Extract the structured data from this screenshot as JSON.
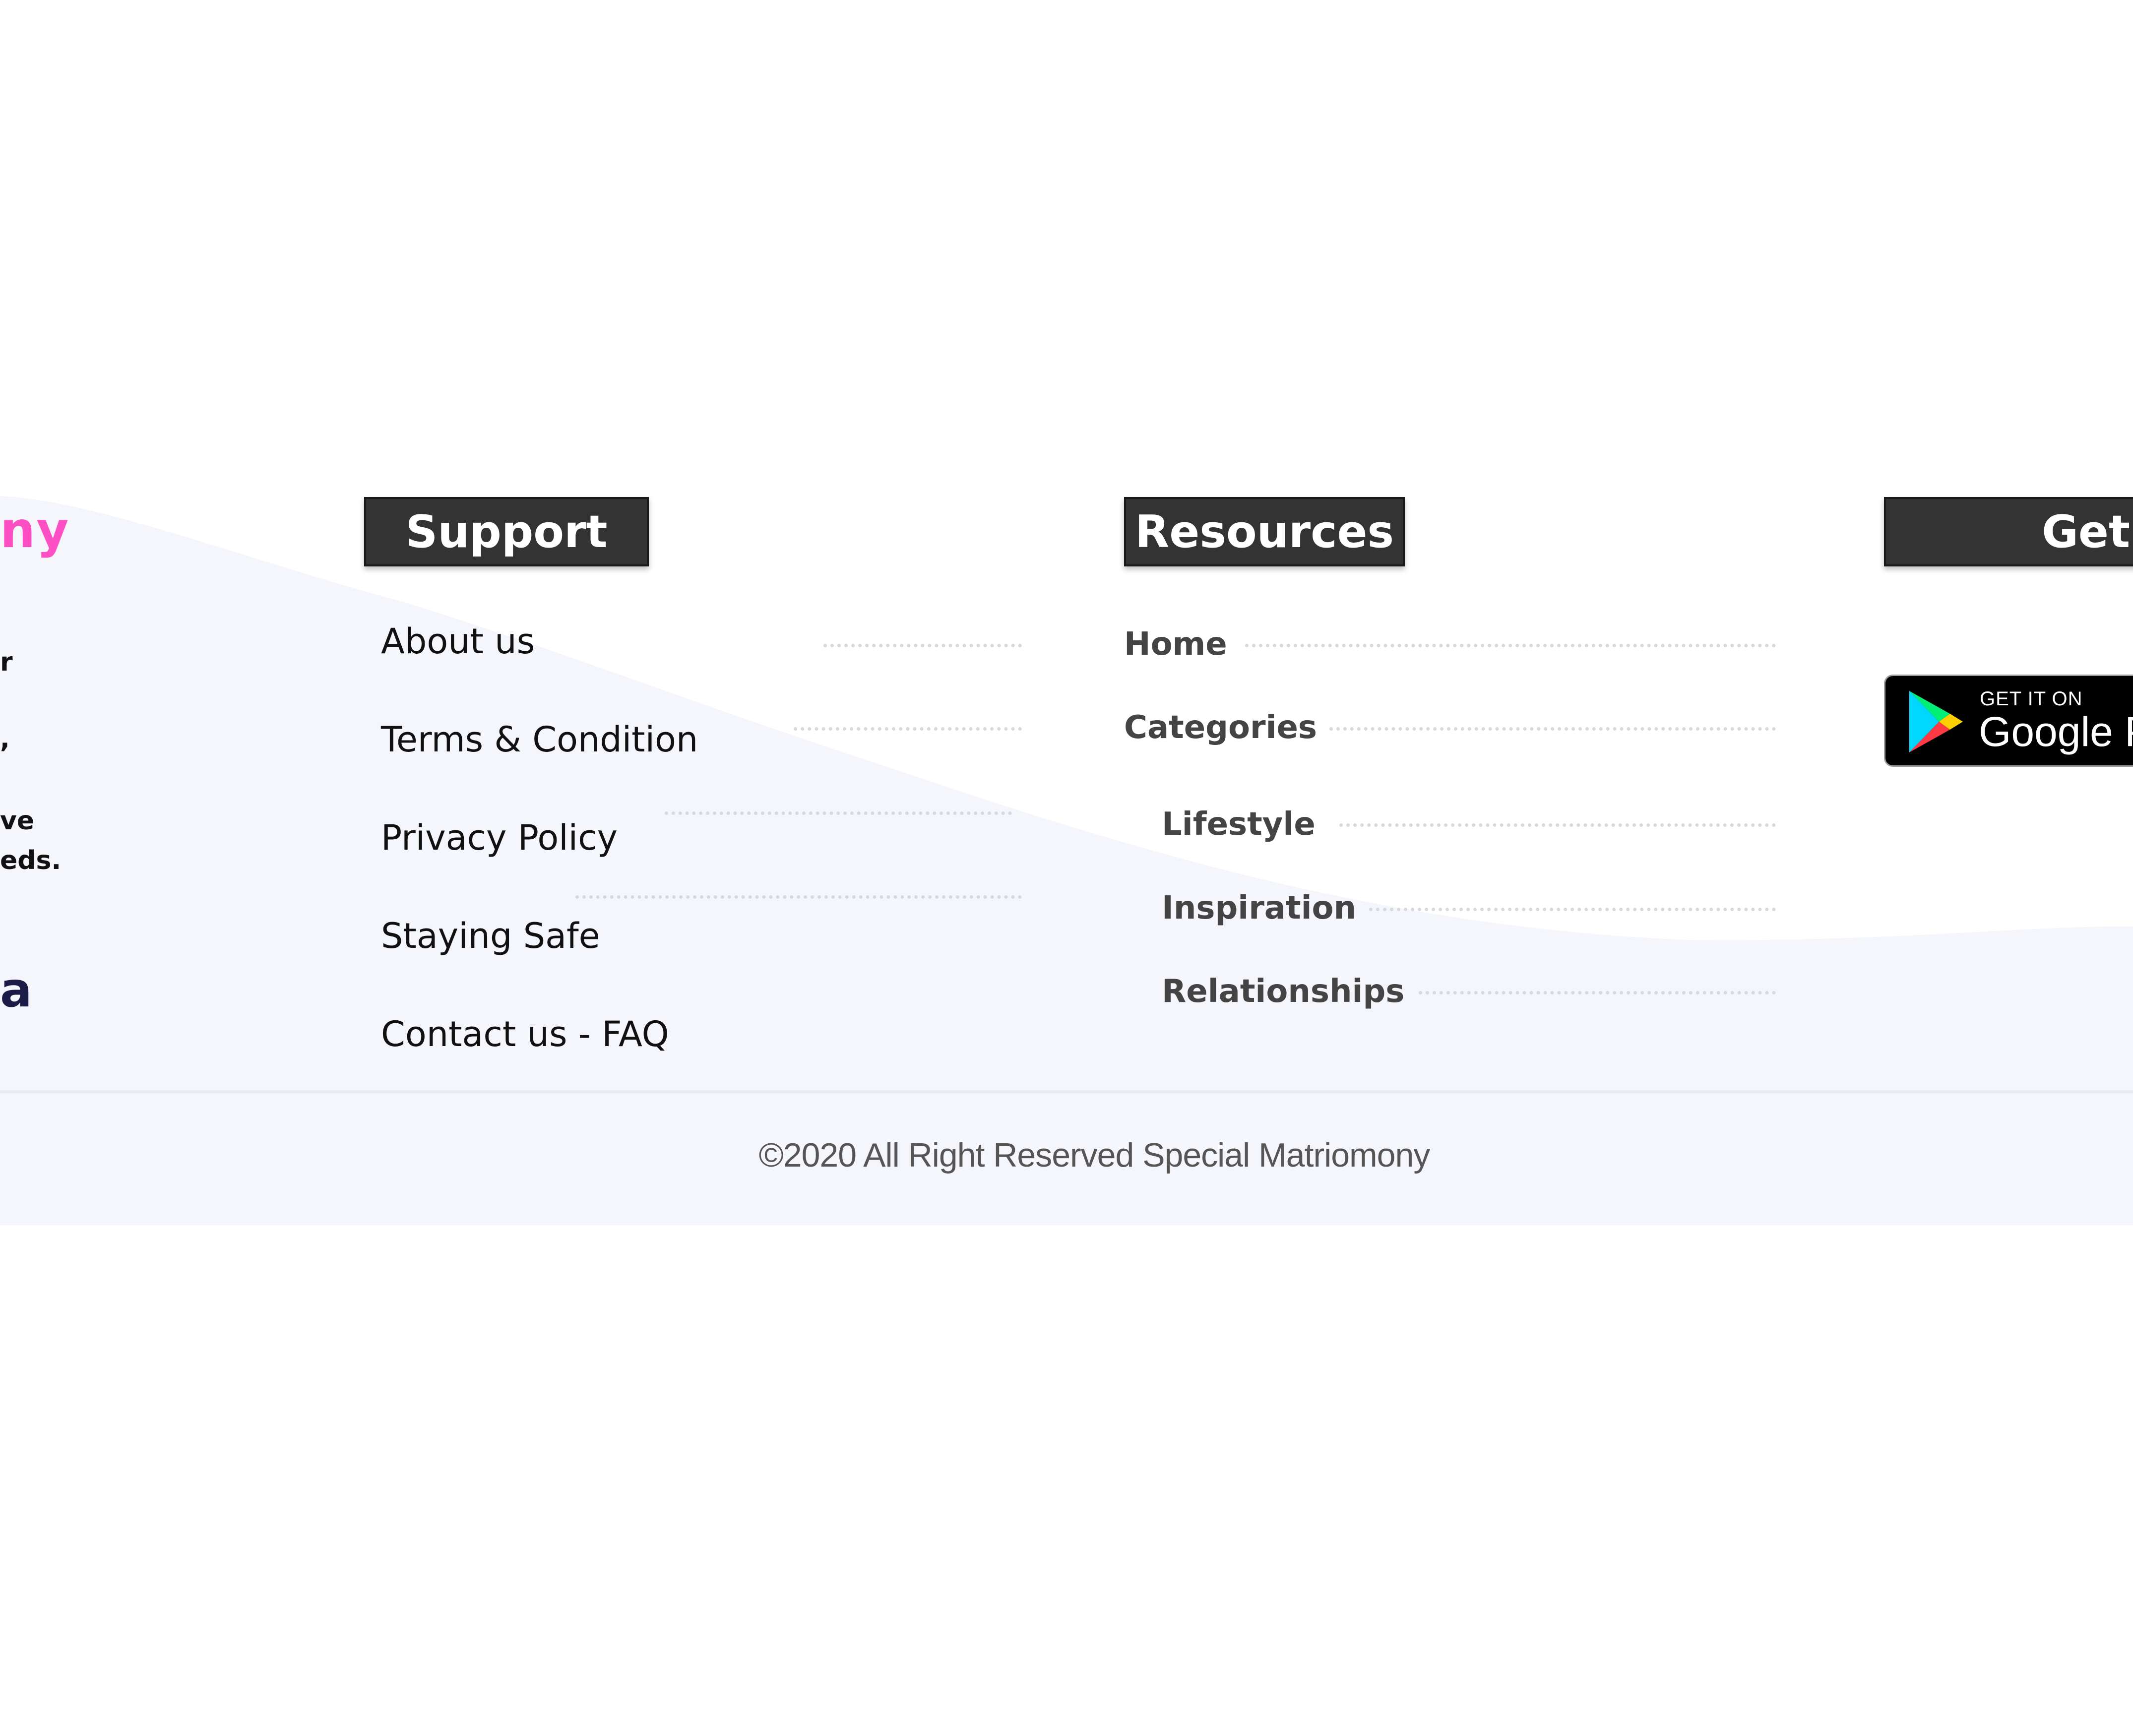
{
  "brand": {
    "name_fragment": "ny"
  },
  "about": {
    "fragments": [
      "r",
      ",",
      "ve",
      "eds."
    ],
    "large_fragment": "a"
  },
  "support": {
    "heading": "Support",
    "links": [
      "About us",
      "Terms & Condition",
      "Privacy Policy",
      "Staying Safe",
      "Contact us - FAQ"
    ]
  },
  "resources": {
    "heading": "Resources",
    "links": [
      "Home",
      "Categories"
    ],
    "sub_links": [
      "Lifestyle",
      "Inspiration",
      "Relationships"
    ]
  },
  "get_app": {
    "heading": "Get",
    "badge": {
      "small_text": "GET IT ON",
      "store_text": "Google P"
    }
  },
  "footer": {
    "copyright": "©2020 All Right Reserved Special Matriomony"
  },
  "colors": {
    "brand_pink": "#ff4fc4",
    "heading_bg": "#333333",
    "footer_bg": "#f4f6fc",
    "link_text": "#444444"
  },
  "icons": [
    "google-play-icon"
  ]
}
